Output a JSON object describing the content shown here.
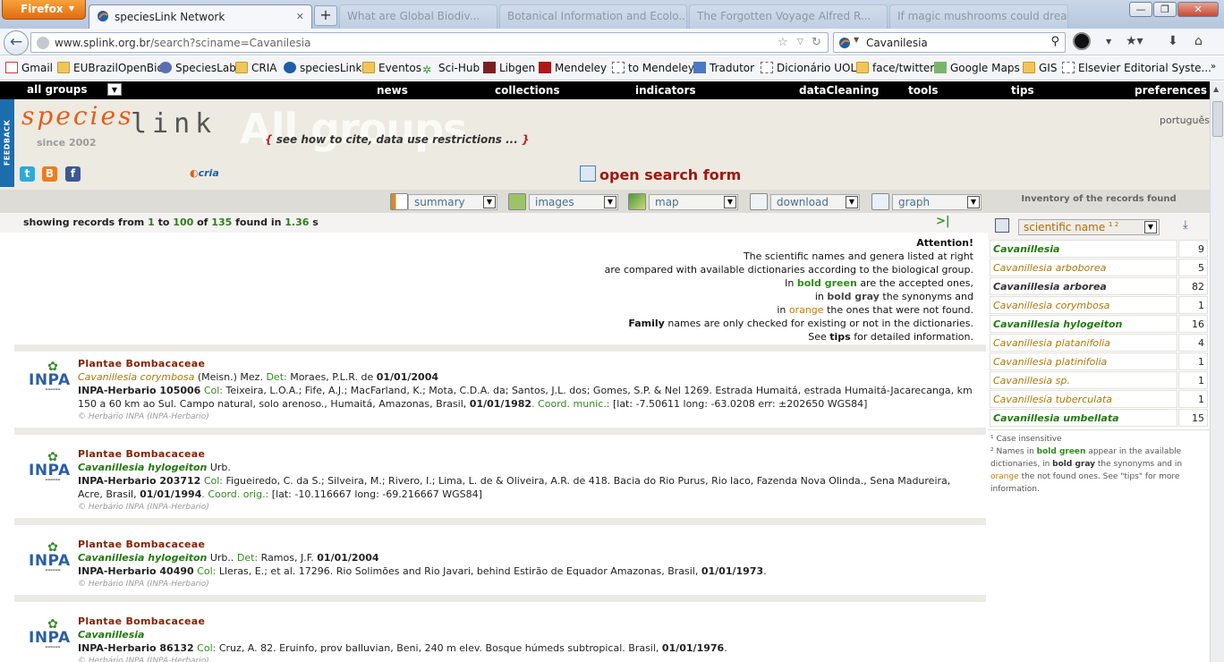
{
  "browser": {
    "menu_button": "Firefox",
    "tabs": [
      {
        "title": "speciesLink Network",
        "active": true
      },
      {
        "title": "What are Global Biodiv...",
        "active": false
      },
      {
        "title": "Botanical Information and Ecolo...",
        "active": false
      },
      {
        "title": "The Forgotten Voyage Alfred R...",
        "active": false
      },
      {
        "title": "If magic mushrooms could dream...",
        "active": false
      }
    ],
    "url_domain": "www.splink.org.br",
    "url_path": "/search?sciname=Cavanilesia",
    "search_value": "Cavanilesia",
    "window": {
      "minimize": "—",
      "restore": "❐",
      "close": "✕"
    }
  },
  "bookmarks": [
    "Gmail",
    "EUBrazilOpenBio",
    "SpeciesLab",
    "CRIA",
    "speciesLink",
    "Eventos",
    "Sci-Hub",
    "Libgen",
    "Mendeley",
    "to Mendeley",
    "Tradutor",
    "Dicionário UOL",
    "face/twitter",
    "Google Maps",
    "GIS",
    "Elsevier Editorial Syste..."
  ],
  "menu": {
    "groups": "all groups",
    "items": [
      "news",
      "collections",
      "indicators",
      "dataCleaning",
      "tools",
      "tips",
      "preferences"
    ]
  },
  "header": {
    "feedback": "FEEDBACK",
    "logo_species": "species",
    "logo_link": "link",
    "logo_group": "All groups",
    "since": "since 2002",
    "cite": "see how to cite, data use restrictions ...",
    "lang": "português",
    "cria": "cria",
    "open_search": "open search form"
  },
  "toolbar": {
    "summary": "summary",
    "images": "images",
    "map": "map",
    "download": "download",
    "graph": "graph"
  },
  "showing": {
    "prefix": "showing records from",
    "from": "1",
    "to_word": "to",
    "to": "100",
    "of_word": "of",
    "total": "135",
    "found_in": "found in",
    "time": "1.36",
    "unit": "s"
  },
  "attention": {
    "title": "Attention!",
    "l1": "The scientific names and genera listed at right",
    "l2": "are compared with available dictionaries according to the biological group.",
    "l3a": "In",
    "l3b": "bold green",
    "l3c": "are the accepted ones,",
    "l4a": "in",
    "l4b": "bold gray",
    "l4c": "the synonyms and",
    "l5a": "in",
    "l5b": "orange",
    "l5c": "the ones that were not found.",
    "l6a": "Family",
    "l6b": "names are only checked for existing or not in the dictionaries.",
    "l7a": "See",
    "l7b": "tips",
    "l7c": "for detailed information."
  },
  "records": [
    {
      "family": "Plantae Bombacaceae",
      "species": "Cavanillesia corymbosa",
      "author": " (Meisn.) Mez.",
      "det_label": " Det:",
      "det": " Moraes, P.L.R. de ",
      "det_date": "01/01/2004",
      "catalog": "INPA-Herbario 105006",
      "col_label": " Col:",
      "col": " Teixeira, L.O.A.; Fife, A.J.; MacFarland, K.; Mota, C.D.A. da; Santos, J.L. dos; Gomes, S.P. & Nel 1269. Estrada Humaitá, estrada Humaitá-Jacarecanga, km 150 a 60 km ao Sul. Campo natural, solo arenoso., Humaitá, Amazonas, Brasil, ",
      "col_date": "01/01/1982",
      "coord_label": ". Coord. munic.:",
      "coord": " [lat: -7.50611 long: -63.0208 err: ±202650 WGS84]",
      "copy": "© Herbário INPA (INPA-Herbario)"
    },
    {
      "family": "Plantae Bombacaceae",
      "species": "Cavanillesia hylogeiton",
      "author": "Urb.",
      "catalog": "INPA-Herbario 203712",
      "col_label": " Col:",
      "col": " Figueiredo, C. da S.; Silveira, M.; Rivero, I.; Lima, L. de & Oliveira, A.R. de 418. Bacia do Rio Purus, Rio Iaco, Fazenda Nova Olinda., Sena Madureira, Acre, Brasil, ",
      "col_date": "01/01/1994",
      "coord_label": ". Coord. orig.:",
      "coord": " [lat: -10.116667 long: -69.216667 WGS84]",
      "copy": "© Herbário INPA (INPA-Herbario)"
    },
    {
      "family": "Plantae Bombacaceae",
      "species": "Cavanillesia hylogeiton",
      "author": "Urb..",
      "det_label": " Det:",
      "det": " Ramos, J.F. ",
      "det_date": "01/01/2004",
      "catalog": "INPA-Herbario 40490",
      "col_label": " Col:",
      "col": " Lleras, E.; et al. 17296. Rio Solimões and Rio Javari, behind Estirão de Equador Amazonas, Brasil, ",
      "col_date": "01/01/1973",
      "copy": "© Herbário INPA (INPA-Herbario)"
    },
    {
      "family": "Plantae Bombacaceae",
      "species": "Cavanillesia",
      "catalog": "INPA-Herbario 86132",
      "col_label": " Col:",
      "col": " Cruz, A. 82. Eruinfo, prov balluvian, Beni, 240 m elev. Bosque húmeds subtropical. Brasil, ",
      "col_date": "01/01/1976",
      "copy": "© Herbário INPA (INPA-Herbario)"
    }
  ],
  "inventory": {
    "title": "Inventory of the records found",
    "select": "scientific name",
    "select_sup": "1 2",
    "items": [
      {
        "name": "Cavanillesia",
        "count": "9",
        "style": "green"
      },
      {
        "name": "Cavanillesia arboborea",
        "count": "5",
        "style": "orange"
      },
      {
        "name": "Cavanillesia arborea",
        "count": "82",
        "style": "gray"
      },
      {
        "name": "Cavanillesia corymbosa",
        "count": "1",
        "style": "orange"
      },
      {
        "name": "Cavanillesia hylogeiton",
        "count": "16",
        "style": "green"
      },
      {
        "name": "Cavanillesia platanifolia",
        "count": "4",
        "style": "orange"
      },
      {
        "name": "Cavanillesia platinifolia",
        "count": "1",
        "style": "orange"
      },
      {
        "name": "Cavanillesia sp.",
        "count": "1",
        "style": "orange"
      },
      {
        "name": "Cavanillesia tuberculata",
        "count": "1",
        "style": "orange"
      },
      {
        "name": "Cavanillesia umbellata",
        "count": "15",
        "style": "green"
      }
    ],
    "note1": "¹ Case insensitive",
    "note2a": "² Names in",
    "note2b": "bold green",
    "note2c": "appear in the available dictionaries, in",
    "note2d": "bold gray",
    "note2e": "the synonyms and in",
    "note2f": "orange",
    "note2g": "the not found ones. See \"tips\" for more information."
  }
}
